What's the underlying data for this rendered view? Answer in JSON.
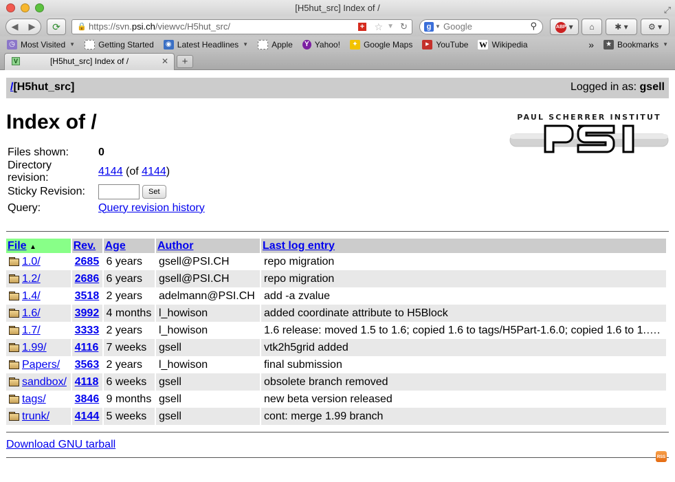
{
  "window": {
    "title": "[H5hut_src] Index of /"
  },
  "toolbar": {
    "back_icon": "◀",
    "forward_icon": "▶",
    "url_scheme_path_prefix": "https://svn.",
    "url_host": "psi.ch",
    "url_rest": "/viewvc/H5hut_src/",
    "search_placeholder": "Google",
    "search_engine_letter": "g",
    "abp_label": "ABP",
    "icons": [
      "back-icon",
      "forward-icon",
      "reload-icon",
      "lock-icon",
      "flag-icon",
      "star-icon",
      "refresh-icon",
      "search-icon",
      "adblock-icon",
      "home-icon",
      "tools-icon",
      "addon-icon"
    ]
  },
  "bookmarks_bar": {
    "items": [
      {
        "label": "Most Visited",
        "icon": "most-visited-icon",
        "dropdown": true
      },
      {
        "label": "Getting Started",
        "icon": "page-icon",
        "dropdown": false
      },
      {
        "label": "Latest Headlines",
        "icon": "rss-icon",
        "dropdown": true
      },
      {
        "label": "Apple",
        "icon": "page-icon",
        "dropdown": false
      },
      {
        "label": "Yahoo!",
        "icon": "yahoo-icon",
        "dropdown": false
      },
      {
        "label": "Google Maps",
        "icon": "maps-icon",
        "dropdown": false
      },
      {
        "label": "YouTube",
        "icon": "youtube-icon",
        "dropdown": false
      },
      {
        "label": "Wikipedia",
        "icon": "wikipedia-icon",
        "dropdown": false
      }
    ],
    "overflow_label": "»",
    "bookmarks_menu_label": "Bookmarks"
  },
  "tabs": [
    {
      "label": "[H5hut_src] Index of /",
      "active": true
    }
  ],
  "new_tab_label": "+",
  "header": {
    "root_link": "/",
    "repo_name": "[H5hut_src]",
    "logged_in_prefix": "Logged in as: ",
    "username": "gsell"
  },
  "page": {
    "title": "Index of /",
    "logo_text_top": "PAUL SCHERRER INSTITUT",
    "logo_text_main": "PSI"
  },
  "info": {
    "files_shown_label": "Files shown:",
    "files_shown_value": "0",
    "dir_revision_label": "Directory revision:",
    "dir_revision_value": "4144",
    "dir_revision_of_prefix": "(of ",
    "dir_revision_head": "4144",
    "dir_revision_of_suffix": ")",
    "sticky_revision_label": "Sticky Revision:",
    "sticky_revision_value": "",
    "set_button": "Set",
    "query_label": "Query:",
    "query_link": "Query revision history"
  },
  "dirlist": {
    "columns": [
      "File",
      "Rev.",
      "Age",
      "Author",
      "Last log entry"
    ],
    "sort_indicator": "▲",
    "rows": [
      {
        "file": "1.0/",
        "rev": "2685",
        "age": "6 years",
        "author": "gsell@PSI.CH",
        "log": "repo migration"
      },
      {
        "file": "1.2/",
        "rev": "2686",
        "age": "6 years",
        "author": "gsell@PSI.CH",
        "log": "repo migration"
      },
      {
        "file": "1.4/",
        "rev": "3518",
        "age": "2 years",
        "author": "adelmann@PSI.CH",
        "log": "add -a zvalue"
      },
      {
        "file": "1.6/",
        "rev": "3992",
        "age": "4 months",
        "author": "l_howison",
        "log": "added coordinate attribute to H5Block"
      },
      {
        "file": "1.7/",
        "rev": "3333",
        "age": "2 years",
        "author": "l_howison",
        "log": "1.6 release: moved 1.5 to 1.6; copied 1.6 to tags/H5Part-1.6.0; copied 1.6 to 1.…."
      },
      {
        "file": "1.99/",
        "rev": "4116",
        "age": "7 weeks",
        "author": "gsell",
        "log": "vtk2h5grid added"
      },
      {
        "file": "Papers/",
        "rev": "3563",
        "age": "2 years",
        "author": "l_howison",
        "log": "final submission"
      },
      {
        "file": "sandbox/",
        "rev": "4118",
        "age": "6 weeks",
        "author": "gsell",
        "log": "obsolete branch removed"
      },
      {
        "file": "tags/",
        "rev": "3846",
        "age": "9 months",
        "author": "gsell",
        "log": "new beta version released"
      },
      {
        "file": "trunk/",
        "rev": "4144",
        "age": "5 weeks",
        "author": "gsell",
        "log": "cont: merge 1.99 branch"
      }
    ]
  },
  "footer": {
    "tarball_link": "Download GNU tarball",
    "rss_label": "RSS"
  }
}
